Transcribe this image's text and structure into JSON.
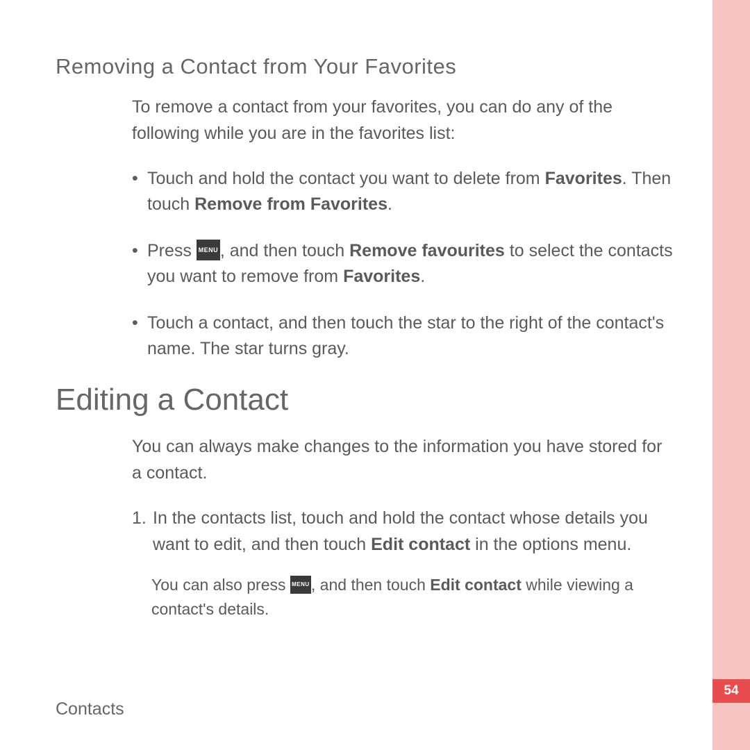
{
  "section1": {
    "heading": "Removing a Contact from Your Favorites",
    "intro": "To remove a contact from your favorites, you can do any of the following while you are in the favorites list:",
    "bullet1_a": "Touch and hold the contact you want to delete from ",
    "bullet1_bold1": "Favorites",
    "bullet1_b": ". Then touch ",
    "bullet1_bold2": "Remove from Favorites",
    "bullet1_c": ".",
    "bullet2_a": "Press ",
    "bullet2_b": ", and then touch ",
    "bullet2_bold1": "Remove favourites",
    "bullet2_c": " to select the contacts you want to remove from ",
    "bullet2_bold2": "Favorites",
    "bullet2_d": ".",
    "bullet3": "Touch a contact, and then touch the star to the right of the contact's name. The star turns gray."
  },
  "section2": {
    "heading": "Editing a Contact",
    "intro": "You can always make changes to the information you have stored for a contact.",
    "step1_a": "In the contacts list, touch and hold the contact whose details you want to edit, and then touch ",
    "step1_bold": "Edit contact",
    "step1_b": " in the options menu.",
    "note_a": "You can also press ",
    "note_b": ", and then touch ",
    "note_bold": "Edit contact",
    "note_c": " while viewing a contact's details."
  },
  "icon_text": "MENU",
  "footer_label": "Contacts",
  "page_number": "54"
}
